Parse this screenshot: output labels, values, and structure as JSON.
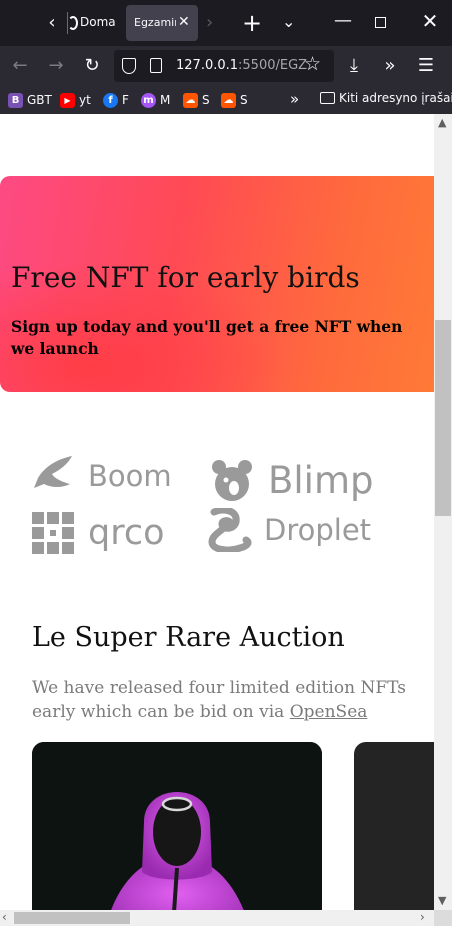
{
  "browser": {
    "tabs": [
      {
        "label": "Doma",
        "active": false
      },
      {
        "label": "Egzamin",
        "active": true
      }
    ],
    "url": {
      "host": "127.0.0.1",
      "rest": ":5500/EGZ"
    },
    "bookmarks": [
      {
        "label": "GBT",
        "icon": "bootstrap-icon",
        "color": "#7952b3",
        "glyph": "B"
      },
      {
        "label": "yt",
        "icon": "youtube-icon",
        "color": "#ff0000",
        "glyph": "▶"
      },
      {
        "label": "F",
        "icon": "facebook-icon",
        "color": "#1877f2",
        "glyph": "f"
      },
      {
        "label": "M",
        "icon": "messenger-icon",
        "color": "#a855f7",
        "glyph": "m"
      },
      {
        "label": "S",
        "icon": "soundcloud-icon",
        "color": "#ff5500",
        "glyph": "☁"
      },
      {
        "label": "S",
        "icon": "soundcloud-icon",
        "color": "#ff5500",
        "glyph": "☁"
      }
    ],
    "other_bookmarks": "Kiti adresyno įrašai"
  },
  "hero": {
    "title": "Free NFT for early birds",
    "subtitle": "Sign up today and you'll get a free NFT when we launch"
  },
  "logos": [
    {
      "name": "Boom",
      "icon": "boom-icon"
    },
    {
      "name": "Blimp",
      "icon": "bear-icon"
    },
    {
      "name": "qrco",
      "icon": "qr-icon"
    },
    {
      "name": "Droplet",
      "icon": "droplet-icon"
    }
  ],
  "auction": {
    "title": "Le Super Rare Auction",
    "desc_before": "We have released four limited edition NFTs early which can be bid on via ",
    "link": "OpenSea"
  },
  "colors": {
    "hero_gradient_start": "#fd4a83",
    "hero_gradient_end": "#ff7a36",
    "logo_gray": "#9a9a9a",
    "figure_purple": "#c43fd6"
  }
}
